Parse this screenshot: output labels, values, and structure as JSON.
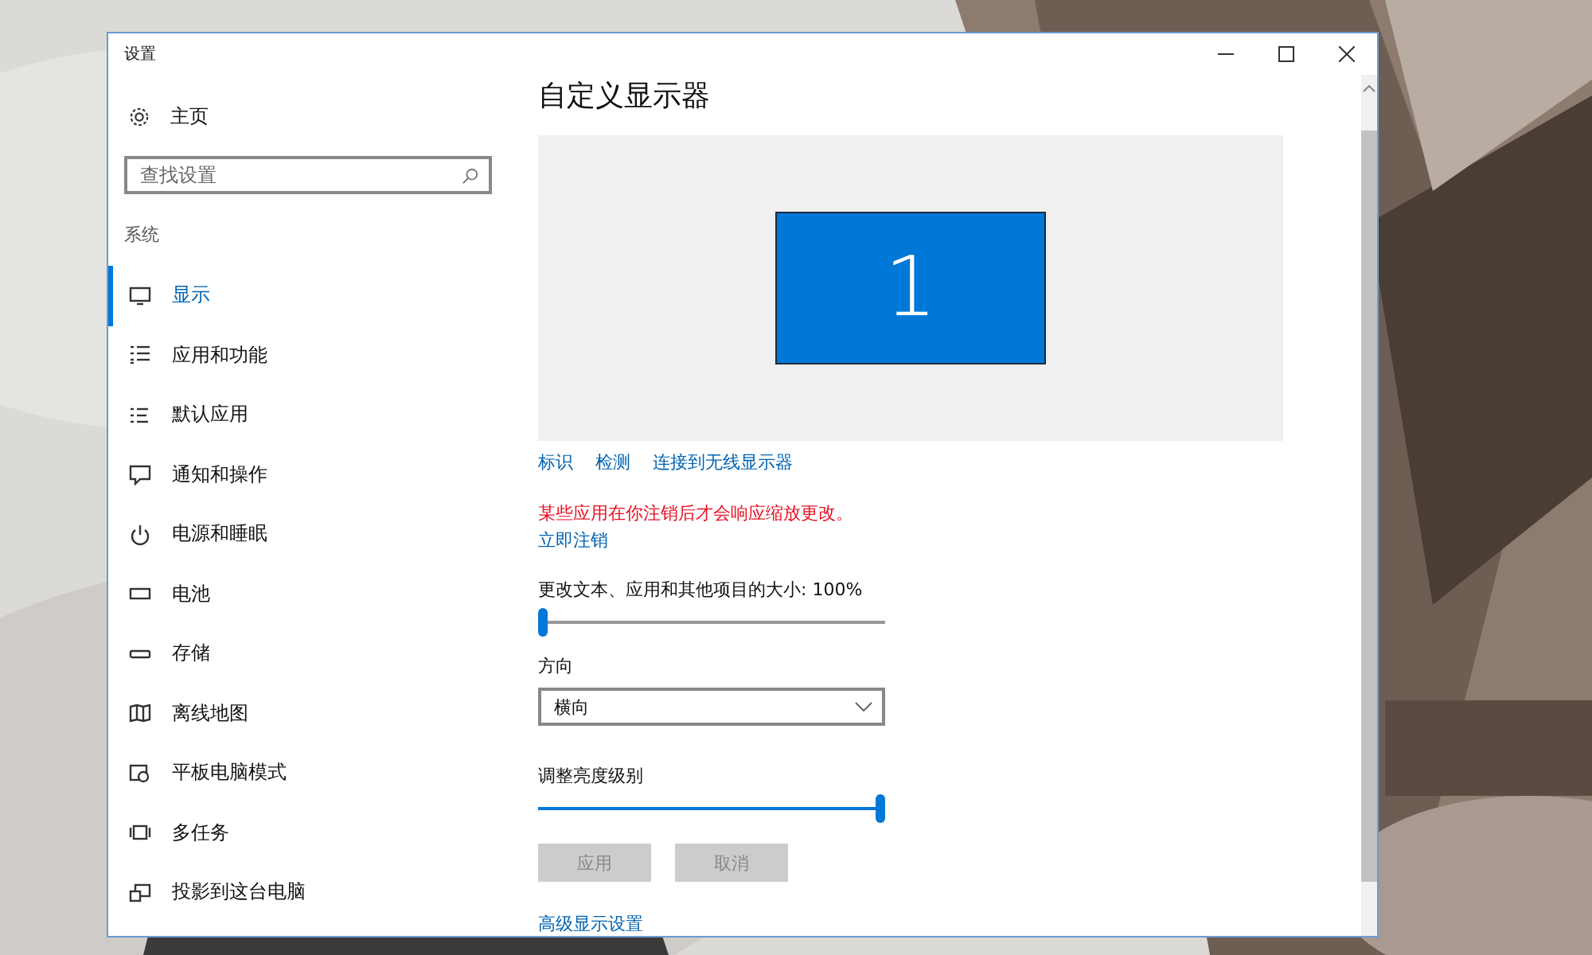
{
  "window": {
    "title": "设置"
  },
  "sidebar": {
    "home": "主页",
    "search": {
      "placeholder": "查找设置"
    },
    "section": "系统",
    "items": [
      {
        "label": "显示",
        "selected": true
      },
      {
        "label": "应用和功能",
        "selected": false
      },
      {
        "label": "默认应用",
        "selected": false
      },
      {
        "label": "通知和操作",
        "selected": false
      },
      {
        "label": "电源和睡眠",
        "selected": false
      },
      {
        "label": "电池",
        "selected": false
      },
      {
        "label": "存储",
        "selected": false
      },
      {
        "label": "离线地图",
        "selected": false
      },
      {
        "label": "平板电脑模式",
        "selected": false
      },
      {
        "label": "多任务",
        "selected": false
      },
      {
        "label": "投影到这台电脑",
        "selected": false
      }
    ]
  },
  "content": {
    "title": "自定义显示器",
    "monitor": "1",
    "links": [
      "标识",
      "检测",
      "连接到无线显示器"
    ],
    "warning": "某些应用在你注销后才会响应缩放更改。",
    "signout_link": "立即注销",
    "scale": {
      "label": "更改文本、应用和其他项目的大小: 100%",
      "level": 0
    },
    "orientation": {
      "label": "方向",
      "value": "横向"
    },
    "brightness": {
      "label": "调整亮度级别",
      "level": 1
    },
    "buttons": [
      {
        "label": "应用",
        "disabled": true
      },
      {
        "label": "取消",
        "disabled": true
      }
    ],
    "advanced_link": "高级显示设置"
  }
}
